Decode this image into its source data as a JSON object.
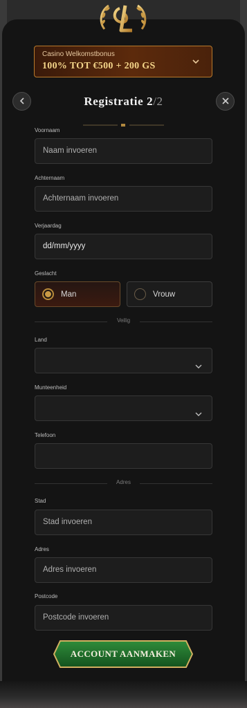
{
  "bonus": {
    "small": "Casino Welkomstbonus",
    "big": "100% TOT €500 + 200 GS"
  },
  "title": {
    "main": "Registratie 2",
    "step_total": "/2"
  },
  "fields": {
    "voornaam": {
      "label": "Voornaam",
      "placeholder": "Naam invoeren"
    },
    "achternaam": {
      "label": "Achternaam",
      "placeholder": "Achternaam invoeren"
    },
    "verjaardag": {
      "label": "Verjaardag",
      "value": "dd/mm/yyyy"
    },
    "geslacht": {
      "label": "Geslacht",
      "options": [
        "Man",
        "Vrouw"
      ],
      "selected": "Man"
    },
    "land": {
      "label": "Land",
      "value": ""
    },
    "munteenheid": {
      "label": "Munteenheid",
      "value": ""
    },
    "telefoon": {
      "label": "Telefoon",
      "value": ""
    },
    "stad": {
      "label": "Stad",
      "placeholder": "Stad invoeren"
    },
    "adres": {
      "label": "Adres",
      "placeholder": "Adres invoeren"
    },
    "postcode": {
      "label": "Postcode",
      "placeholder": "Postcode invoeren"
    }
  },
  "dividers": {
    "veilig": "Veilig",
    "adres": "Adres"
  },
  "cta": {
    "label": "Account aanmaken"
  },
  "icons": {
    "logo": "casino-logo-icon",
    "chevron": "chevron-down-icon",
    "back": "chevron-left-icon",
    "close": "close-icon"
  },
  "colors": {
    "gold": "#c99a45",
    "panel": "#141414",
    "cta_green": "#1f6b2a"
  }
}
